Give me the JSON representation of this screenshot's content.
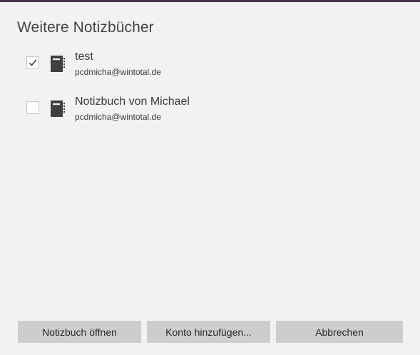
{
  "dialog": {
    "title": "Weitere Notizbücher"
  },
  "notebooks": [
    {
      "name": "test",
      "account": "pcdmicha@wintotal.de",
      "checked": true,
      "icon": "notebook-icon"
    },
    {
      "name": "Notizbuch von Michael",
      "account": "pcdmicha@wintotal.de",
      "checked": false,
      "icon": "notebook-icon"
    }
  ],
  "buttons": {
    "open_label": "Notizbuch öffnen",
    "add_account_label": "Konto hinzufügen...",
    "cancel_label": "Abbrechen"
  },
  "colors": {
    "background": "#f2f2f2",
    "button_background": "#cdcdcd",
    "top_border": "#4a2f48",
    "icon": "#3f3f3f"
  }
}
